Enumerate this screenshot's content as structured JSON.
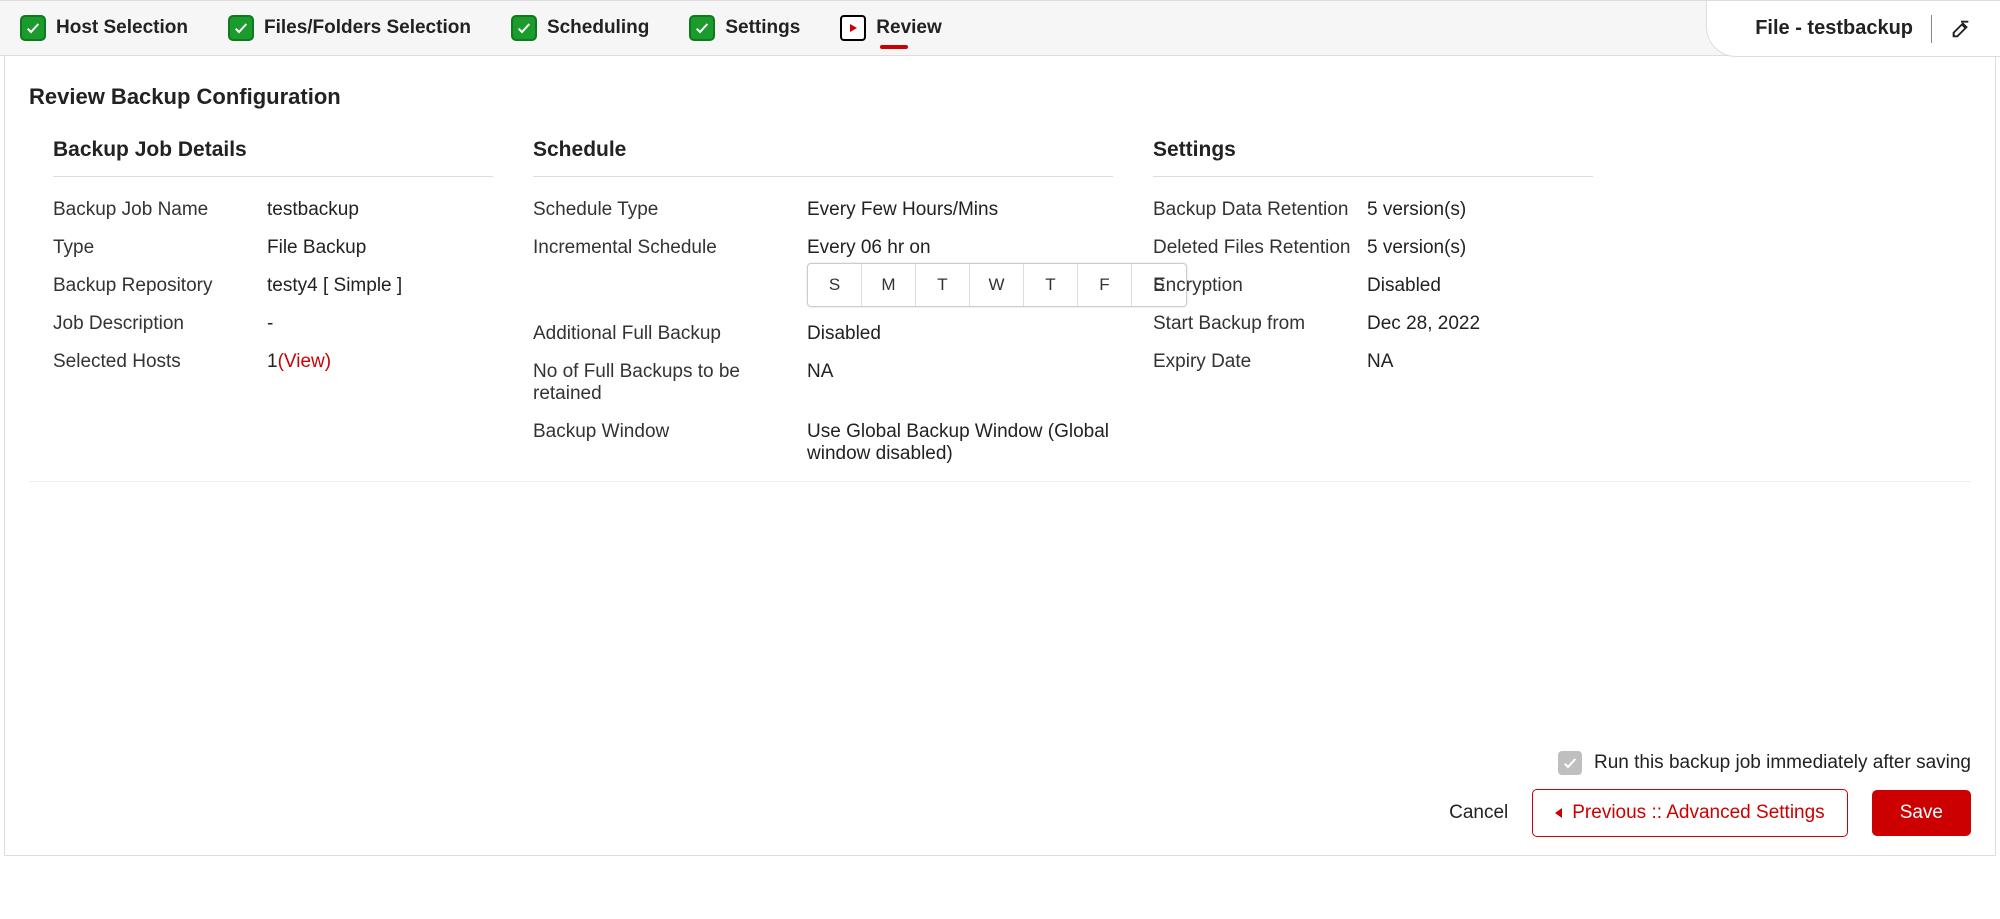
{
  "header": {
    "context_label": "File - testbackup"
  },
  "steps": [
    {
      "label": "Host Selection",
      "state": "done"
    },
    {
      "label": "Files/Folders Selection",
      "state": "done"
    },
    {
      "label": "Scheduling",
      "state": "done"
    },
    {
      "label": "Settings",
      "state": "done"
    },
    {
      "label": "Review",
      "state": "active"
    }
  ],
  "page_title": "Review Backup Configuration",
  "details": {
    "title": "Backup Job Details",
    "job_name_label": "Backup Job Name",
    "job_name": "testbackup",
    "type_label": "Type",
    "type": "File Backup",
    "repo_label": "Backup Repository",
    "repo": "testy4 [ Simple ]",
    "desc_label": "Job Description",
    "desc": "-",
    "hosts_label": "Selected Hosts",
    "hosts_count": "1",
    "hosts_view": "(View)"
  },
  "schedule": {
    "title": "Schedule",
    "type_label": "Schedule Type",
    "type": "Every Few Hours/Mins",
    "incr_label": "Incremental Schedule",
    "incr": "Every 06 hr on",
    "days": [
      "S",
      "M",
      "T",
      "W",
      "T",
      "F",
      "S"
    ],
    "full_label": "Additional Full Backup",
    "full": "Disabled",
    "retain_label": "No of Full Backups to be retained",
    "retain": "NA",
    "window_label": "Backup Window",
    "window": "Use Global Backup Window  (Global window disabled)"
  },
  "settings": {
    "title": "Settings",
    "data_ret_label": "Backup Data Retention",
    "data_ret": "5 version(s)",
    "del_ret_label": "Deleted Files Retention",
    "del_ret": "5 version(s)",
    "enc_label": "Encryption",
    "enc": "Disabled",
    "start_label": "Start Backup from",
    "start": "Dec 28, 2022",
    "expiry_label": "Expiry Date",
    "expiry": "NA"
  },
  "footer": {
    "run_label": "Run this backup job immediately after saving",
    "cancel": "Cancel",
    "previous": "Previous :: Advanced Settings",
    "save": "Save"
  }
}
